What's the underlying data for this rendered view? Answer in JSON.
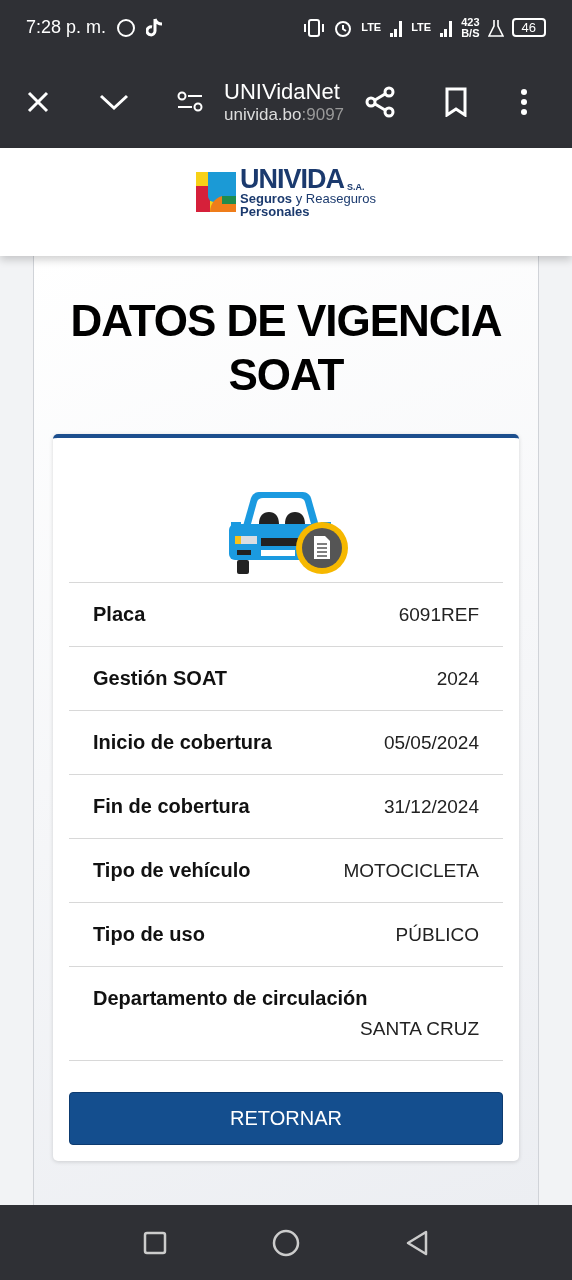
{
  "status_bar": {
    "time": "7:28 p. m.",
    "network_1": "LTE",
    "network_2": "LTE",
    "speed": "423",
    "speed_unit": "B/S",
    "battery": "46"
  },
  "browser_bar": {
    "title": "UNIVidaNet",
    "host": "univida.bo",
    "port": ":9097"
  },
  "logo": {
    "brand": "UNIVIDA",
    "suffix": "S.A.",
    "tagline_1": "**Seguros** y Reaseguros",
    "tagline_2": "Personales"
  },
  "heading": "DATOS DE VIGENCIA SOAT",
  "details": [
    {
      "label": "Placa",
      "value": "6091REF"
    },
    {
      "label": "Gestión SOAT",
      "value": "2024"
    },
    {
      "label": "Inicio de cobertura",
      "value": "05/05/2024"
    },
    {
      "label": "Fin de cobertura",
      "value": "31/12/2024"
    },
    {
      "label": "Tipo de vehículo",
      "value": "MOTOCICLETA"
    },
    {
      "label": "Tipo de uso",
      "value": "PÚBLICO"
    },
    {
      "label": "Departamento de circulación",
      "value": "SANTA CRUZ"
    }
  ],
  "button": "RETORNAR"
}
